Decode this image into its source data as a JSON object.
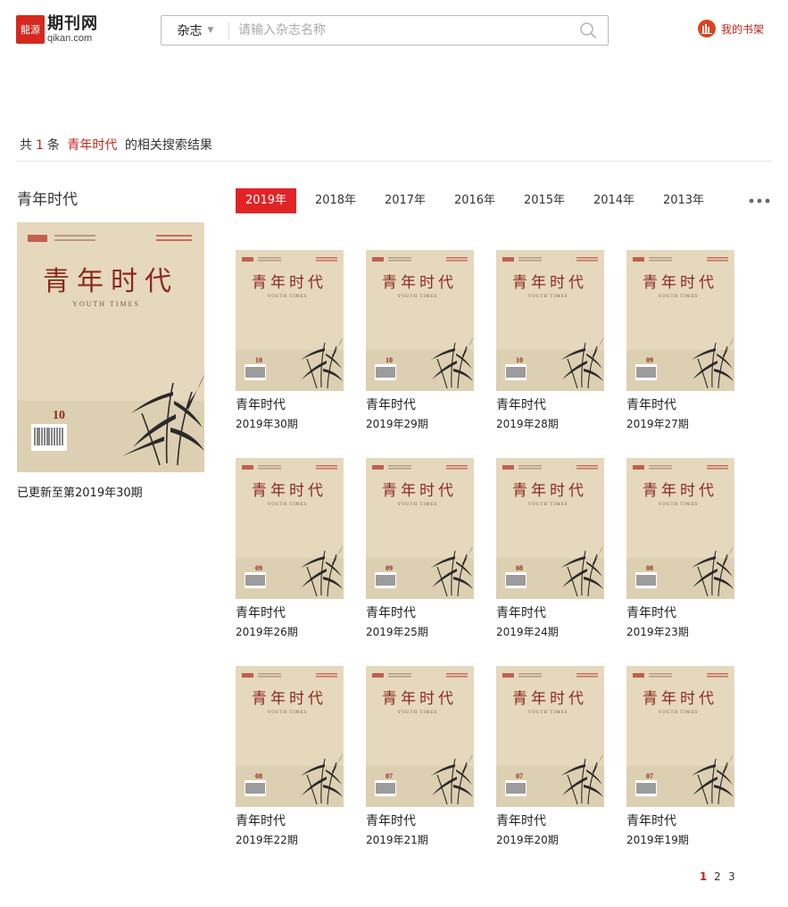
{
  "header": {
    "logo_mark": "龍源",
    "logo_cn": "期刊网",
    "logo_en": "qikan.com",
    "search_category": "杂志",
    "search_placeholder": "请输入杂志名称",
    "shelf_label": "我的书架"
  },
  "summary": {
    "prefix": "共",
    "count": "1",
    "unit": "条",
    "keyword": "青年时代",
    "suffix": "的相关搜索结果"
  },
  "magazine": {
    "name": "青年时代",
    "cover_title": "青年时代",
    "cover_subtitle": "YOUTH TIMES",
    "cover_issue": "10",
    "updated": "已更新至第2019年30期"
  },
  "years": [
    "2019年",
    "2018年",
    "2017年",
    "2016年",
    "2015年",
    "2014年",
    "2013年"
  ],
  "active_year": 0,
  "issues": [
    {
      "title": "青年时代",
      "issue": "2019年30期",
      "cover_no": "10"
    },
    {
      "title": "青年时代",
      "issue": "2019年29期",
      "cover_no": "10"
    },
    {
      "title": "青年时代",
      "issue": "2019年28期",
      "cover_no": "10"
    },
    {
      "title": "青年时代",
      "issue": "2019年27期",
      "cover_no": "09"
    },
    {
      "title": "青年时代",
      "issue": "2019年26期",
      "cover_no": "09"
    },
    {
      "title": "青年时代",
      "issue": "2019年25期",
      "cover_no": "09"
    },
    {
      "title": "青年时代",
      "issue": "2019年24期",
      "cover_no": "08"
    },
    {
      "title": "青年时代",
      "issue": "2019年23期",
      "cover_no": "08"
    },
    {
      "title": "青年时代",
      "issue": "2019年22期",
      "cover_no": "08"
    },
    {
      "title": "青年时代",
      "issue": "2019年21期",
      "cover_no": "07"
    },
    {
      "title": "青年时代",
      "issue": "2019年20期",
      "cover_no": "07"
    },
    {
      "title": "青年时代",
      "issue": "2019年19期",
      "cover_no": "07"
    }
  ],
  "pagination": {
    "pages": [
      "1",
      "2",
      "3"
    ],
    "current": 0
  },
  "colors": {
    "accent": "#e02426",
    "brand": "#c2241c",
    "cover_bg": "#e6d8bd",
    "cover_text": "#8a2a1e"
  }
}
